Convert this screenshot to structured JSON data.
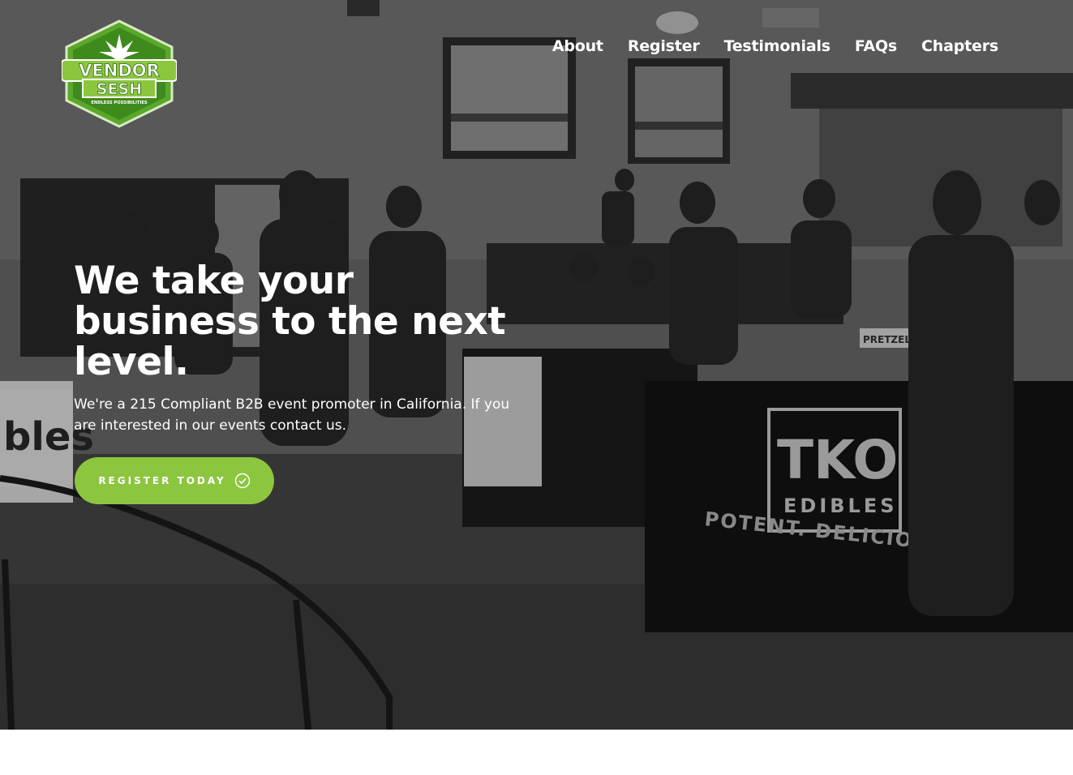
{
  "brand": {
    "logo_line1": "VENDOR",
    "logo_line2": "SESH",
    "logo_tagline": "ENDLESS POSSIBILITIES",
    "accent_color": "#8cc63f"
  },
  "nav": {
    "items": [
      {
        "label": "About"
      },
      {
        "label": "Register"
      },
      {
        "label": "Testimonials"
      },
      {
        "label": "FAQs"
      },
      {
        "label": "Chapters"
      }
    ]
  },
  "hero": {
    "headline": "We take your business to the next level.",
    "subtext": "We're a 215 Compliant B2B event promoter in California. If you are interested in our events contact us.",
    "cta_label": "REGISTER TODAY",
    "cta_icon": "check-circle-icon",
    "background_signs": {
      "brand_top": "TKO",
      "brand_bottom": "EDIBLES",
      "banner_text": "POTENT. DELICIOUS. EVE",
      "left_table_text": "bles",
      "pretzels": "PRETZELS"
    }
  }
}
